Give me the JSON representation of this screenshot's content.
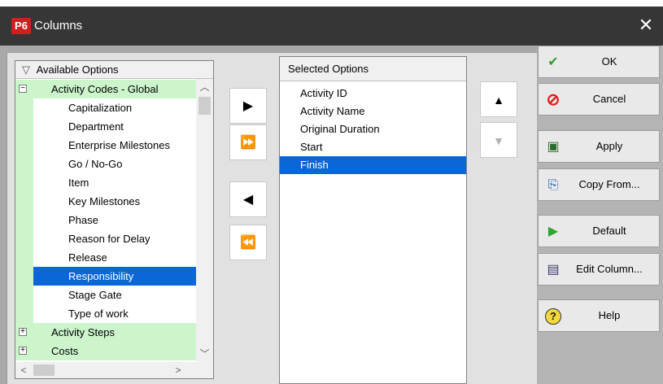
{
  "window": {
    "app_badge": "P6",
    "title": "Columns",
    "close_glyph": "✕"
  },
  "available": {
    "header": "Available Options",
    "header_icon": "▽",
    "items": [
      {
        "label": "Activity Codes - Global",
        "type": "group",
        "expander": "−"
      },
      {
        "label": "Capitalization",
        "type": "child"
      },
      {
        "label": "Department",
        "type": "child"
      },
      {
        "label": "Enterprise Milestones",
        "type": "child"
      },
      {
        "label": "Go / No-Go",
        "type": "child"
      },
      {
        "label": "Item",
        "type": "child"
      },
      {
        "label": "Key Milestones",
        "type": "child"
      },
      {
        "label": "Phase",
        "type": "child"
      },
      {
        "label": "Reason for Delay",
        "type": "child"
      },
      {
        "label": "Release",
        "type": "child"
      },
      {
        "label": "Responsibility",
        "type": "child",
        "selected": true
      },
      {
        "label": "Stage Gate",
        "type": "child"
      },
      {
        "label": "Type of work",
        "type": "child"
      },
      {
        "label": "Activity Steps",
        "type": "group",
        "expander": "+"
      },
      {
        "label": "Costs",
        "type": "group",
        "expander": "+"
      }
    ]
  },
  "move_buttons": {
    "add": "▶",
    "add_all": "⏩",
    "remove": "◀",
    "remove_all": "⏪"
  },
  "selected": {
    "header": "Selected Options",
    "items": [
      "Activity ID",
      "Activity Name",
      "Original Duration",
      "Start",
      "Finish"
    ],
    "selected_item": "Finish"
  },
  "order_buttons": {
    "up": "▲",
    "down": "▼"
  },
  "actions": [
    {
      "label": "OK",
      "icon": "check-icon",
      "glyph": "✔",
      "color": "#2e9e2e"
    },
    {
      "label": "Cancel",
      "icon": "cancel-icon",
      "glyph": "⊘",
      "color": "#e01b1b"
    },
    {
      "label": "Apply",
      "icon": "apply-icon",
      "glyph": "▣",
      "color": "#2b6b2b"
    },
    {
      "label": "Copy From...",
      "icon": "copy-icon",
      "glyph": "⎘",
      "color": "#1e5ab4"
    },
    {
      "label": "Default",
      "icon": "default-icon",
      "glyph": "▶",
      "color": "#2ea52e"
    },
    {
      "label": "Edit Column...",
      "icon": "edit-column-icon",
      "glyph": "▤",
      "color": "#3a3a6a"
    },
    {
      "label": "Help",
      "icon": "help-icon",
      "glyph": "?",
      "color": "#1a1a1a"
    }
  ],
  "colors": {
    "selection": "#0b66d6",
    "group_bg": "#ccf5cc",
    "titlebar": "#363636"
  }
}
